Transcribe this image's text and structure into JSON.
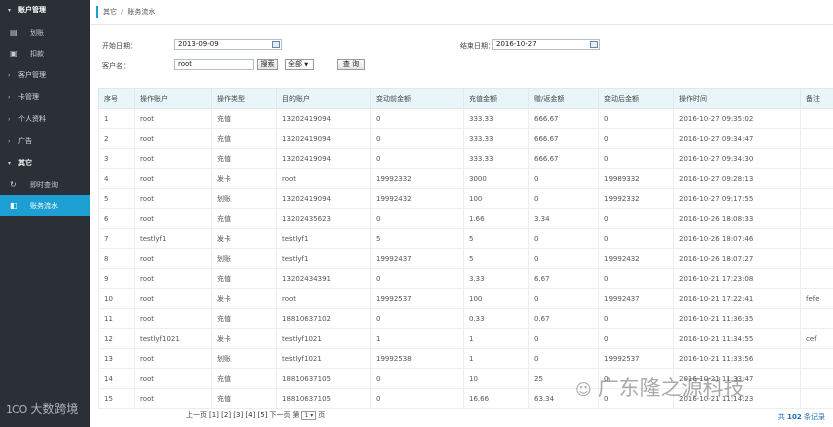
{
  "sidebar": {
    "account_mgmt": "账户管理",
    "transfer": "划账",
    "deduct": "扣款",
    "customer_mgmt": "客户管理",
    "card_mgmt": "卡管理",
    "personal_info": "个人资料",
    "ads": "广告",
    "other": "其它",
    "instant_query": "即时查询",
    "account_flow": "账务流水"
  },
  "breadcrumb": {
    "parent": "其它",
    "sep": "/",
    "current": "账务流水"
  },
  "filters": {
    "start_label": "开始日期：",
    "start_value": "2013-09-09",
    "end_label": "结束日期：",
    "end_value": "2016-10-27",
    "customer_label": "客户名：",
    "customer_value": "root",
    "search_btn": "搜索",
    "type_select": "全部",
    "query_btn": "查 询"
  },
  "table": {
    "headers": [
      "序号",
      "操作账户",
      "操作类型",
      "目的账户",
      "变动前金额",
      "充值金额",
      "赠/返金额",
      "变动后金额",
      "操作时间",
      "备注"
    ],
    "rows": [
      [
        "1",
        "root",
        "充值",
        "13202419094",
        "0",
        "333.33",
        "666.67",
        "0",
        "2016-10-27 09:35:02",
        ""
      ],
      [
        "2",
        "root",
        "充值",
        "13202419094",
        "0",
        "333.33",
        "666.67",
        "0",
        "2016-10-27 09:34:47",
        ""
      ],
      [
        "3",
        "root",
        "充值",
        "13202419094",
        "0",
        "333.33",
        "666.67",
        "0",
        "2016-10-27 09:34:30",
        ""
      ],
      [
        "4",
        "root",
        "发卡",
        "root",
        "19992332",
        "3000",
        "0",
        "19989332",
        "2016-10-27 09:28:13",
        ""
      ],
      [
        "5",
        "root",
        "划账",
        "13202419094",
        "19992432",
        "100",
        "0",
        "19992332",
        "2016-10-27 09:17:55",
        ""
      ],
      [
        "6",
        "root",
        "充值",
        "13202435623",
        "0",
        "1.66",
        "3.34",
        "0",
        "2016-10-26 18:08:33",
        ""
      ],
      [
        "7",
        "testlyf1",
        "发卡",
        "testlyf1",
        "5",
        "5",
        "0",
        "0",
        "2016-10-26 18:07:46",
        ""
      ],
      [
        "8",
        "root",
        "划账",
        "testlyf1",
        "19992437",
        "5",
        "0",
        "19992432",
        "2016-10-26 18:07:27",
        ""
      ],
      [
        "9",
        "root",
        "充值",
        "13202434391",
        "0",
        "3.33",
        "6.67",
        "0",
        "2016-10-21 17:23:08",
        ""
      ],
      [
        "10",
        "root",
        "发卡",
        "root",
        "19992537",
        "100",
        "0",
        "19992437",
        "2016-10-21 17:22:41",
        "fefe"
      ],
      [
        "11",
        "root",
        "充值",
        "18810637102",
        "0",
        "0.33",
        "0.67",
        "0",
        "2016-10-21 11:36:35",
        ""
      ],
      [
        "12",
        "testlyf1021",
        "发卡",
        "testlyf1021",
        "1",
        "1",
        "0",
        "0",
        "2016-10-21 11:34:55",
        "cef"
      ],
      [
        "13",
        "root",
        "划账",
        "testlyf1021",
        "19992538",
        "1",
        "0",
        "19992537",
        "2016-10-21 11:33:56",
        ""
      ],
      [
        "14",
        "root",
        "充值",
        "18810637105",
        "0",
        "10",
        "25",
        "0",
        "2016-10-21 11:33:47",
        ""
      ],
      [
        "15",
        "root",
        "充值",
        "18810637105",
        "0",
        "16.66",
        "63.34",
        "0",
        "2016-10-21 11:14:23",
        ""
      ]
    ]
  },
  "pagination": {
    "prev": "上一页",
    "pages": "[1] [2] [3] [4] [5]",
    "next": "下一页",
    "jump_label": "第",
    "jump_value": "1",
    "page_unit": "页"
  },
  "total": {
    "prefix": "共",
    "count": "102",
    "suffix": "条记录"
  },
  "watermarks": {
    "left": "大数跨境",
    "left_logo": "1CO",
    "right": "广东隆之源科技"
  }
}
